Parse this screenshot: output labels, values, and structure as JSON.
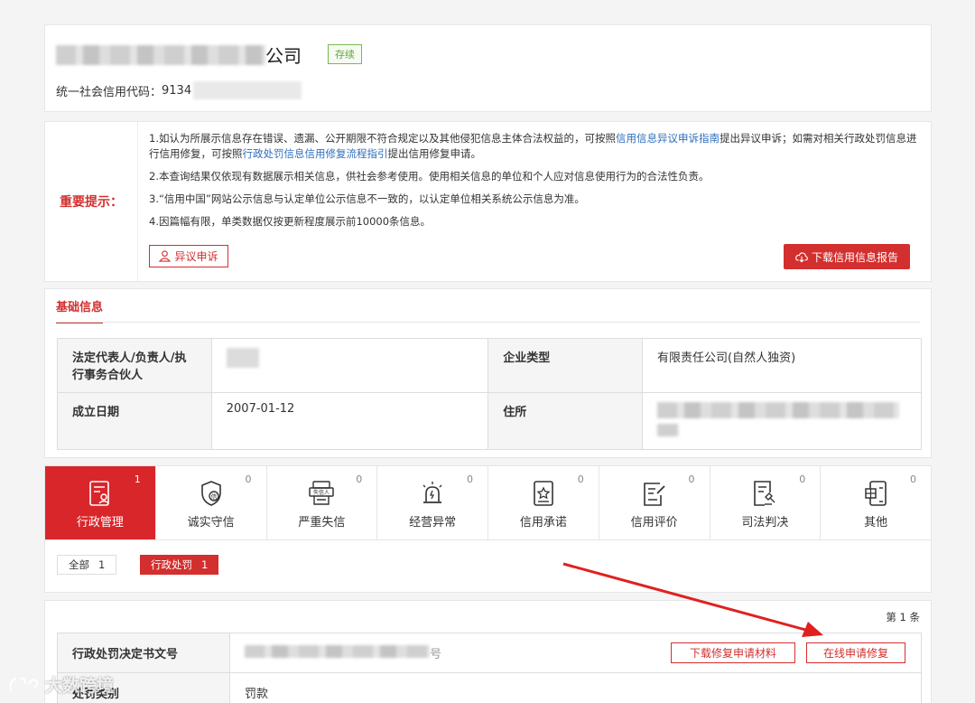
{
  "header": {
    "company_suffix": "公司",
    "status": "存续",
    "credit_code_label": "统一社会信用代码：",
    "credit_code_prefix": "9134"
  },
  "notice": {
    "label": "重要提示：",
    "p1_a": "1.如认为所展示信息存在错误、遗漏、公开期限不符合规定以及其他侵犯信息主体合法权益的，可按照",
    "p1_link1": "信用信息异议申诉指南",
    "p1_b": "提出异议申诉；如需对相关行政处罚信息进行信用修复，可按照",
    "p1_link2": "行政处罚信息信用修复流程指引",
    "p1_c": "提出信用修复申请。",
    "p2": "2.本查询结果仅依现有数据展示相关信息，供社会参考使用。使用相关信息的单位和个人应对信息使用行为的合法性负责。",
    "p3": "3.“信用中国”网站公示信息与认定单位公示信息不一致的，以认定单位相关系统公示信息为准。",
    "p4": "4.因篇幅有限，单类数据仅按更新程度展示前10000条信息。",
    "appeal_button": "异议申诉",
    "download_button": "下载信用信息报告"
  },
  "basic": {
    "section_title": "基础信息",
    "legal_rep_label": "法定代表人/负责人/执行事务合伙人",
    "company_type_label": "企业类型",
    "company_type_value": "有限责任公司(自然人独资)",
    "founded_label": "成立日期",
    "founded_value": "2007-01-12",
    "address_label": "住所"
  },
  "categories": [
    {
      "label": "行政管理",
      "count": "1",
      "icon": "admin-doc-icon"
    },
    {
      "label": "诚实守信",
      "count": "0",
      "icon": "shield-credit-icon"
    },
    {
      "label": "严重失信",
      "count": "0",
      "icon": "dishonest-person-icon"
    },
    {
      "label": "经营异常",
      "count": "0",
      "icon": "alarm-light-icon"
    },
    {
      "label": "信用承诺",
      "count": "0",
      "icon": "promise-star-icon"
    },
    {
      "label": "信用评价",
      "count": "0",
      "icon": "evaluation-edit-icon"
    },
    {
      "label": "司法判决",
      "count": "0",
      "icon": "judgment-doc-icon"
    },
    {
      "label": "其他",
      "count": "0",
      "icon": "other-doc-icon"
    }
  ],
  "filters": {
    "all_label": "全部",
    "all_count": "1",
    "admin_label": "行政处罚",
    "admin_count": "1"
  },
  "result": {
    "page_info": "第 1 条",
    "decision_no_label": "行政处罚决定书文号",
    "decision_no_suffix": "号",
    "category_label": "处罚类别",
    "category_value": "罚款",
    "download_fix_button": "下载修复申请材料",
    "online_fix_button": "在线申请修复"
  },
  "watermark": "大数跨境",
  "colors": {
    "accent": "#d32f2f",
    "status_green": "#5ea836",
    "link": "#2f6ebd"
  }
}
